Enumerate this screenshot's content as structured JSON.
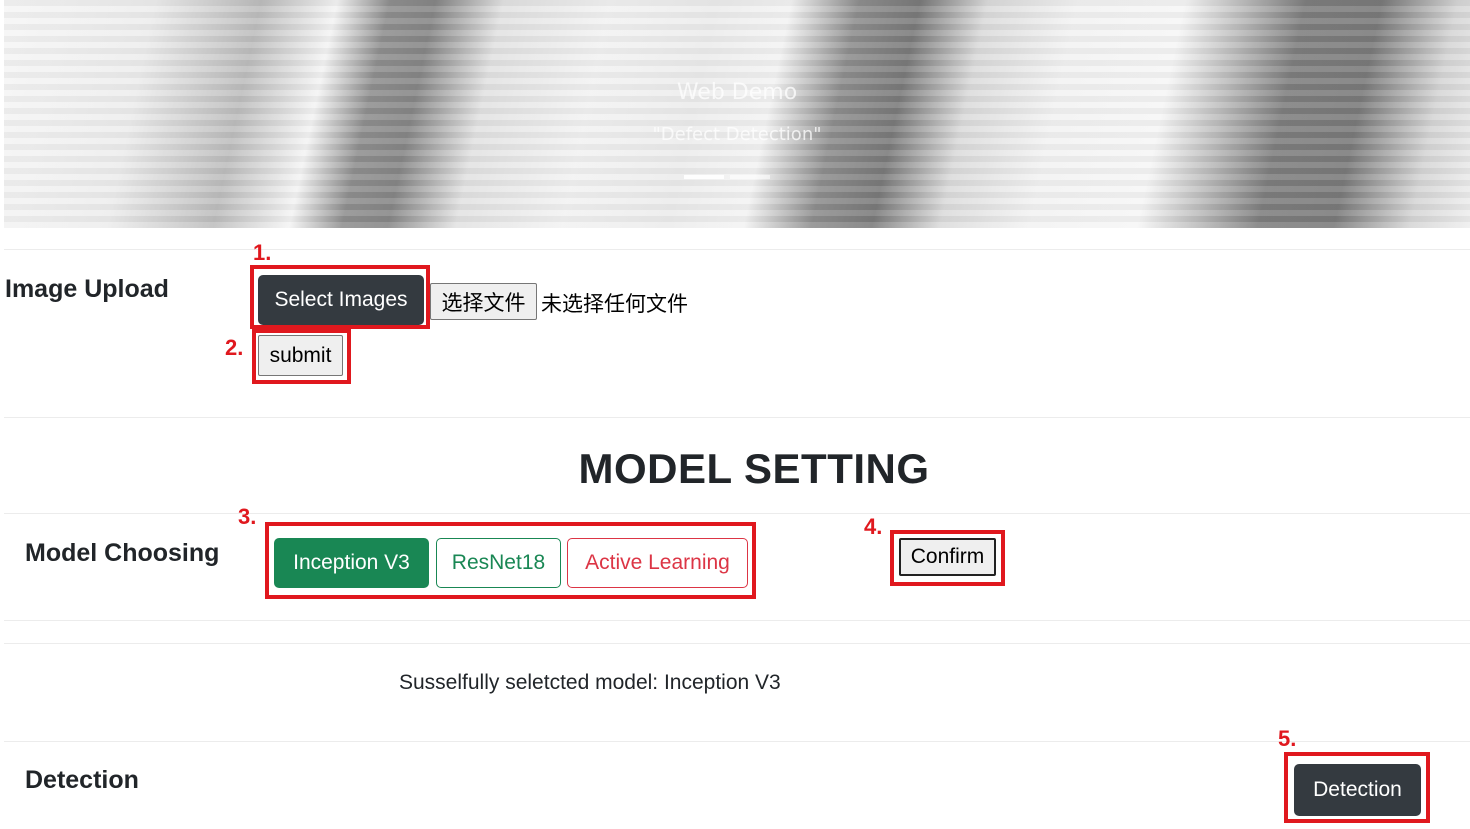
{
  "hero": {
    "title": "Web Demo",
    "subtitle": "\"Defect Detection\""
  },
  "image_upload": {
    "label": "Image Upload",
    "select_button": "Select Images",
    "choose_file_button": "选择文件",
    "no_file_text": "未选择任何文件",
    "submit_button": "submit"
  },
  "model_setting": {
    "heading": "MODEL SETTING",
    "label": "Model Choosing",
    "models": [
      "Inception V3",
      "ResNet18",
      "Active Learning"
    ],
    "selected_model": "Inception V3",
    "confirm_button": "Confirm",
    "status_text": "Susselfully seletcted model: Inception V3"
  },
  "detection": {
    "label": "Detection",
    "button": "Detection"
  },
  "annotations": [
    "1.",
    "2.",
    "3.",
    "4.",
    "5."
  ],
  "colors": {
    "annotation": "#e0181e",
    "dark_button": "#343a40",
    "success": "#198754",
    "danger": "#dc3545"
  }
}
